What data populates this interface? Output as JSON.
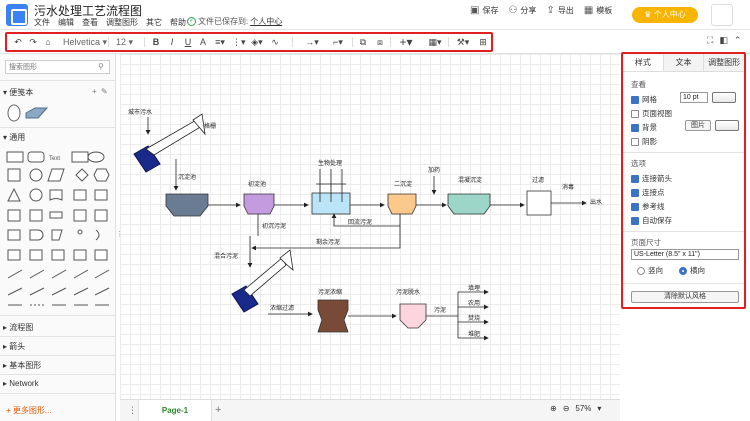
{
  "header": {
    "title": "污水处理工艺流程图",
    "menu": [
      "文件",
      "编辑",
      "查看",
      "调整图形",
      "其它",
      "帮助"
    ],
    "save_status": "文件已保存到:",
    "save_location": "个人中心",
    "actions": {
      "save": "保存",
      "share": "分享",
      "export": "导出",
      "templates": "模板"
    },
    "vip_button": "个人中心"
  },
  "toolbar": {
    "font_name": "Helvetica",
    "font_size": "12",
    "tools": [
      "undo-icon",
      "redo-icon",
      "format-paint-icon",
      "bold-icon",
      "italic-icon",
      "underline-icon",
      "font-color-icon",
      "align-icon",
      "more-icon",
      "fill-color-icon",
      "line-color-icon",
      "connector-icon",
      "waypoint-icon",
      "to-front-icon",
      "to-back-icon",
      "insert-icon",
      "table-icon",
      "magic-icon",
      "grid-apps-icon"
    ],
    "labels": {
      "bold": "B",
      "italic": "I",
      "underline": "U"
    }
  },
  "sidebar": {
    "search_placeholder": "搜索图形",
    "sections": {
      "scratchpad": "便笺本",
      "general": "通用",
      "flowchart": "流程图",
      "arrows": "箭头",
      "basic": "基本图形",
      "network": "Network"
    },
    "shape_texts": {
      "text": "Text"
    },
    "more_shapes": "+ 更多图形..."
  },
  "diagram": {
    "labels": {
      "city_sewage": "城市污水",
      "grille": "格栅",
      "grit_tank": "沉淀池",
      "primary_tank": "初淀池",
      "bio_treatment": "生物处理",
      "secondary_tank": "二沉淀",
      "dosing": "加药",
      "mixing_tank": "混凝沉淀",
      "filtration": "过滤",
      "disinfection": "消毒",
      "outlet": "出水",
      "primary_sludge": "初沉污泥",
      "return_sludge": "回流污泥",
      "excess_sludge": "剩余污泥",
      "mixed_sludge": "混合污泥",
      "thickening_filter": "浓缩过滤",
      "sludge_thickener": "污泥浓缩",
      "sludge_dewatering": "污泥脱水",
      "sludge": "污泥",
      "landfill": "填埋",
      "farmland": "农用",
      "incineration": "焚烧",
      "compost": "堆肥",
      "conveyor_top": "格栅",
      "conveyor_bottom": "格栅"
    }
  },
  "bottom": {
    "page_tab": "Page-1",
    "zoom": "57%"
  },
  "panel": {
    "tabs": [
      "样式",
      "文本",
      "调整图形"
    ],
    "view_heading": "查看",
    "grid_label": "网格",
    "grid_size": "10 pt",
    "page_view_label": "页面视图",
    "background_label": "背景",
    "background_image_button": "图片",
    "shadow_label": "阴影",
    "options_heading": "选项",
    "connection_arrows": "连接箭头",
    "connection_points": "连接点",
    "guides": "参考线",
    "autosave": "自动保存",
    "paper_heading": "页面尺寸",
    "paper_size": "US-Letter (8.5\" x 11\")",
    "portrait": "竖向",
    "landscape": "横向",
    "clear_style_button": "清除默认风格"
  }
}
